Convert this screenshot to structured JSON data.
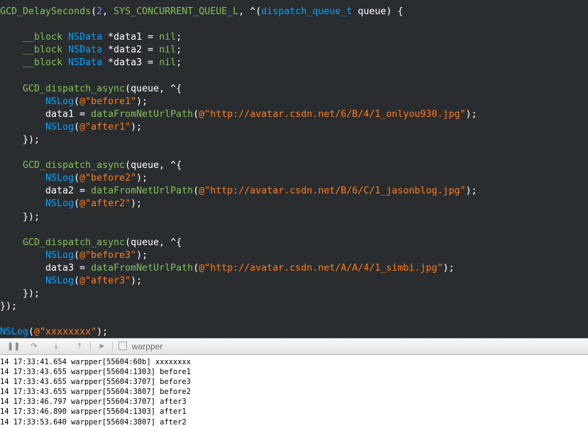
{
  "editor": {
    "code_lines": [
      [
        {
          "t": "GCD_DelaySeconds",
          "c": "fn"
        },
        {
          "t": "(",
          "c": "plain"
        },
        {
          "t": "2",
          "c": "num"
        },
        {
          "t": ", ",
          "c": "plain"
        },
        {
          "t": "SYS_CONCURRENT_QUEUE_L",
          "c": "macro"
        },
        {
          "t": ", ^(",
          "c": "plain"
        },
        {
          "t": "dispatch_queue_t",
          "c": "type"
        },
        {
          "t": " queue) {",
          "c": "plain"
        }
      ],
      [],
      [
        {
          "t": "    ",
          "c": "plain"
        },
        {
          "t": "__block",
          "c": "kw"
        },
        {
          "t": " ",
          "c": "plain"
        },
        {
          "t": "NSData",
          "c": "type"
        },
        {
          "t": " *data1 = ",
          "c": "plain"
        },
        {
          "t": "nil",
          "c": "kw"
        },
        {
          "t": ";",
          "c": "plain"
        }
      ],
      [
        {
          "t": "    ",
          "c": "plain"
        },
        {
          "t": "__block",
          "c": "kw"
        },
        {
          "t": " ",
          "c": "plain"
        },
        {
          "t": "NSData",
          "c": "type"
        },
        {
          "t": " *data2 = ",
          "c": "plain"
        },
        {
          "t": "nil",
          "c": "kw"
        },
        {
          "t": ";",
          "c": "plain"
        }
      ],
      [
        {
          "t": "    ",
          "c": "plain"
        },
        {
          "t": "__block",
          "c": "kw"
        },
        {
          "t": " ",
          "c": "plain"
        },
        {
          "t": "NSData",
          "c": "type"
        },
        {
          "t": " *data3 = ",
          "c": "plain"
        },
        {
          "t": "nil",
          "c": "kw"
        },
        {
          "t": ";",
          "c": "plain"
        }
      ],
      [],
      [
        {
          "t": "    ",
          "c": "plain"
        },
        {
          "t": "GCD_dispatch_async",
          "c": "fn"
        },
        {
          "t": "(queue, ^{",
          "c": "plain"
        }
      ],
      [
        {
          "t": "        ",
          "c": "plain"
        },
        {
          "t": "NSLog",
          "c": "nslog"
        },
        {
          "t": "(",
          "c": "plain"
        },
        {
          "t": "@\"before1\"",
          "c": "str"
        },
        {
          "t": ");",
          "c": "plain"
        }
      ],
      [
        {
          "t": "        data1 = ",
          "c": "plain"
        },
        {
          "t": "dataFromNetUrlPath",
          "c": "fn"
        },
        {
          "t": "(",
          "c": "plain"
        },
        {
          "t": "@\"http://avatar.csdn.net/6/B/4/1_onlyou930.jpg\"",
          "c": "str"
        },
        {
          "t": ");",
          "c": "plain"
        }
      ],
      [
        {
          "t": "        ",
          "c": "plain"
        },
        {
          "t": "NSLog",
          "c": "nslog"
        },
        {
          "t": "(",
          "c": "plain"
        },
        {
          "t": "@\"after1\"",
          "c": "str"
        },
        {
          "t": ");",
          "c": "plain"
        }
      ],
      [
        {
          "t": "    });",
          "c": "plain"
        }
      ],
      [],
      [
        {
          "t": "    ",
          "c": "plain"
        },
        {
          "t": "GCD_dispatch_async",
          "c": "fn"
        },
        {
          "t": "(queue, ^{",
          "c": "plain"
        }
      ],
      [
        {
          "t": "        ",
          "c": "plain"
        },
        {
          "t": "NSLog",
          "c": "nslog"
        },
        {
          "t": "(",
          "c": "plain"
        },
        {
          "t": "@\"before2\"",
          "c": "str"
        },
        {
          "t": ");",
          "c": "plain"
        }
      ],
      [
        {
          "t": "        data2 = ",
          "c": "plain"
        },
        {
          "t": "dataFromNetUrlPath",
          "c": "fn"
        },
        {
          "t": "(",
          "c": "plain"
        },
        {
          "t": "@\"http://avatar.csdn.net/B/6/C/1_jasonblog.jpg\"",
          "c": "str"
        },
        {
          "t": ");",
          "c": "plain"
        }
      ],
      [
        {
          "t": "        ",
          "c": "plain"
        },
        {
          "t": "NSLog",
          "c": "nslog"
        },
        {
          "t": "(",
          "c": "plain"
        },
        {
          "t": "@\"after2\"",
          "c": "str"
        },
        {
          "t": ");",
          "c": "plain"
        }
      ],
      [
        {
          "t": "    });",
          "c": "plain"
        }
      ],
      [],
      [
        {
          "t": "    ",
          "c": "plain"
        },
        {
          "t": "GCD_dispatch_async",
          "c": "fn"
        },
        {
          "t": "(queue, ^{",
          "c": "plain"
        }
      ],
      [
        {
          "t": "        ",
          "c": "plain"
        },
        {
          "t": "NSLog",
          "c": "nslog"
        },
        {
          "t": "(",
          "c": "plain"
        },
        {
          "t": "@\"before3\"",
          "c": "str"
        },
        {
          "t": ");",
          "c": "plain"
        }
      ],
      [
        {
          "t": "        data3 = ",
          "c": "plain"
        },
        {
          "t": "dataFromNetUrlPath",
          "c": "fn"
        },
        {
          "t": "(",
          "c": "plain"
        },
        {
          "t": "@\"http://avatar.csdn.net/A/A/4/1_simbi.jpg\"",
          "c": "str"
        },
        {
          "t": ");",
          "c": "plain"
        }
      ],
      [
        {
          "t": "        ",
          "c": "plain"
        },
        {
          "t": "NSLog",
          "c": "nslog"
        },
        {
          "t": "(",
          "c": "plain"
        },
        {
          "t": "@\"after3\"",
          "c": "str"
        },
        {
          "t": ");",
          "c": "plain"
        }
      ],
      [
        {
          "t": "    });",
          "c": "plain"
        }
      ],
      [
        {
          "t": "});",
          "c": "plain"
        }
      ],
      [],
      [
        {
          "t": "NSLog",
          "c": "nslog"
        },
        {
          "t": "(",
          "c": "plain"
        },
        {
          "t": "@\"xxxxxxxx\"",
          "c": "str"
        },
        {
          "t": ");",
          "c": "plain"
        }
      ]
    ]
  },
  "debug_bar": {
    "buttons": [
      {
        "name": "pause-icon",
        "glyph": "❚❚"
      },
      {
        "name": "step-over-icon",
        "glyph": "↷"
      },
      {
        "name": "step-into-icon",
        "glyph": "⤓"
      },
      {
        "name": "step-out-icon",
        "glyph": "⤒"
      },
      {
        "name": "location-icon",
        "glyph": "➤"
      }
    ],
    "target_label": "warpper"
  },
  "console": {
    "lines": [
      "14 17:33:41.654 warpper[55604:60b] xxxxxxxx",
      "14 17:33:43.655 warpper[55604:1303] before1",
      "14 17:33:43.655 warpper[55604:3707] before3",
      "14 17:33:43.655 warpper[55604:3807] before2",
      "14 17:33:46.797 warpper[55604:3707] after3",
      "14 17:33:46.890 warpper[55604:1303] after1",
      "14 17:33:53.640 warpper[55604:3807] after2"
    ]
  },
  "colors": {
    "editor_background": "#2a2d30",
    "function": "#83c057",
    "type": "#00a0ff",
    "number": "#8d82f0",
    "string": "#ff7a1a",
    "plain": "#ffffff"
  }
}
